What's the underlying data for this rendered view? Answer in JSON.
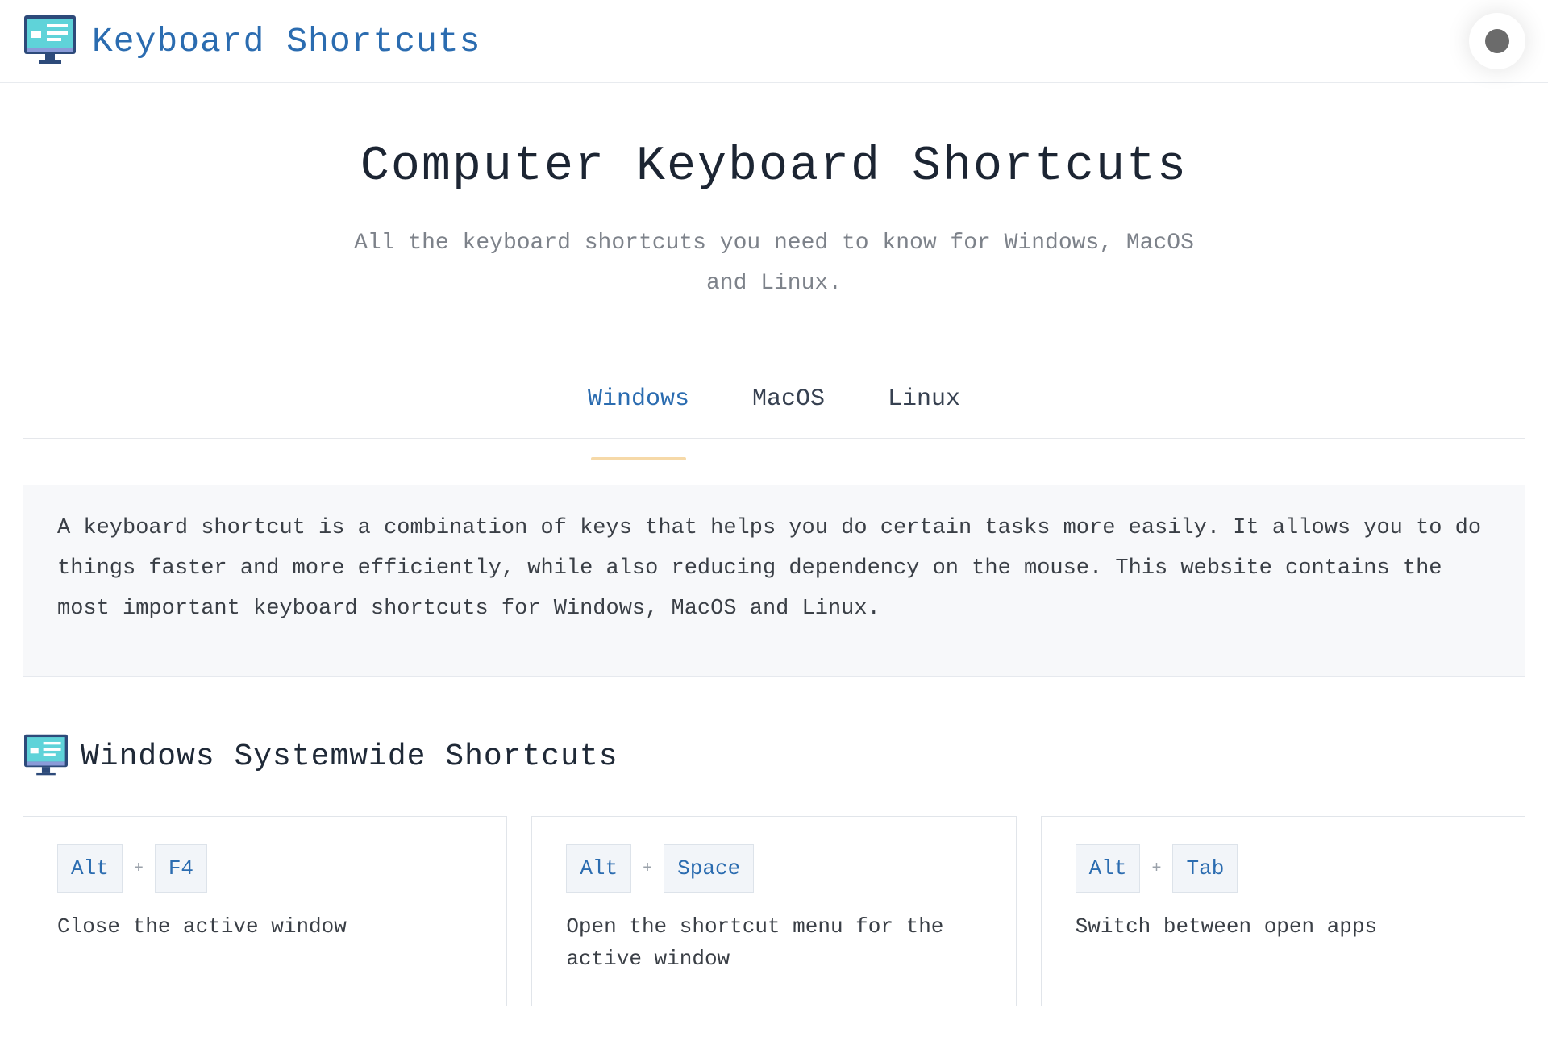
{
  "header": {
    "brand_title": "Keyboard Shortcuts",
    "logo_icon": "monitor-icon",
    "theme_toggle_icon": "circle-toggle-icon"
  },
  "hero": {
    "title": "Computer Keyboard Shortcuts",
    "subtitle": "All the keyboard shortcuts you need to know for Windows, MacOS and Linux."
  },
  "tabs": [
    {
      "label": "Windows",
      "active": true
    },
    {
      "label": "MacOS",
      "active": false
    },
    {
      "label": "Linux",
      "active": false
    }
  ],
  "intro_text": "A keyboard shortcut is a combination of keys that helps you do certain tasks more easily. It allows you to do things faster and more efficiently, while also reducing dependency on the mouse. This website contains the most important keyboard shortcuts for Windows, MacOS and Linux.",
  "section": {
    "title": "Windows Systemwide Shortcuts",
    "icon": "monitor-icon"
  },
  "shortcuts": [
    {
      "keys": [
        "Alt",
        "F4"
      ],
      "separator": "+",
      "description": "Close the active window"
    },
    {
      "keys": [
        "Alt",
        "Space"
      ],
      "separator": "+",
      "description": "Open the shortcut menu for the active window"
    },
    {
      "keys": [
        "Alt",
        "Tab"
      ],
      "separator": "+",
      "description": "Switch between open apps"
    }
  ],
  "colors": {
    "accent": "#2b6cb0",
    "tab_underline": "#f6d9a8",
    "intro_bg": "#f7f8fa"
  }
}
